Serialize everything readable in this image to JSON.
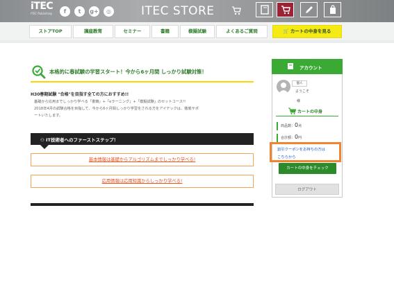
{
  "header": {
    "logo": "iTEC",
    "logo_sub": "ITEC Publishing",
    "store_title": "ITEC STORE",
    "social": [
      {
        "name": "facebook-icon",
        "glyph": "f"
      },
      {
        "name": "twitter-icon",
        "glyph": "t"
      },
      {
        "name": "google-plus-icon",
        "glyph": "g+"
      },
      {
        "name": "instagram-icon",
        "glyph": "◎"
      }
    ],
    "icon_buttons": [
      {
        "name": "book-icon"
      },
      {
        "name": "cart-icon"
      },
      {
        "name": "pencil-icon"
      },
      {
        "name": "bag-icon"
      }
    ]
  },
  "nav": {
    "items": [
      "ストアTOP",
      "講座教育",
      "セミナー",
      "書籍",
      "模擬試験",
      "よくあるご質問"
    ],
    "cart_label": "カートの中身を見る"
  },
  "promo": {
    "title": "本格的に春試験の学習スタート！今から6ヶ月間 しっかり試験対策！"
  },
  "intro": {
    "heading": "H30春期試験 \"合格\"を目指す全ての方におすすめ!!",
    "lines": [
      "基礎から応用までしっかり学べる「書籍」+「eラーニング」+「模擬試験」のセットコース!!",
      "2018年4月の試験合格を目指して、今から6ヶ月間しっかり学習をされる方をアイテックは、徹底サポ",
      "ートいたします。"
    ]
  },
  "steps": {
    "label": "IT技術者へのファーストステップ！",
    "links": [
      "基本情報は基礎からアルゴリズムまでしっかり学べる!",
      "応用情報は応用知識からしっかり学べる!"
    ]
  },
  "account": {
    "title": "アカウント",
    "user_tag": "個人",
    "welcome": "ようこそ",
    "sama": "様",
    "cart_title": "カートの中身",
    "quantity_label": "商品数：",
    "quantity_value": "0",
    "quantity_unit": "点",
    "total_label": "合計額：",
    "total_value": "0",
    "total_unit": "円",
    "coupon_line1": "割引クーポンをお持ちの方は",
    "coupon_line2": "こちらから",
    "check_cart": "カートの中身をチェック",
    "logout": "ログアウト"
  },
  "colors": {
    "accent_green": "#3aaa35",
    "cart_yellow": "#f5ea14",
    "highlight_orange": "#f08430",
    "link_orange": "#e8501c"
  }
}
